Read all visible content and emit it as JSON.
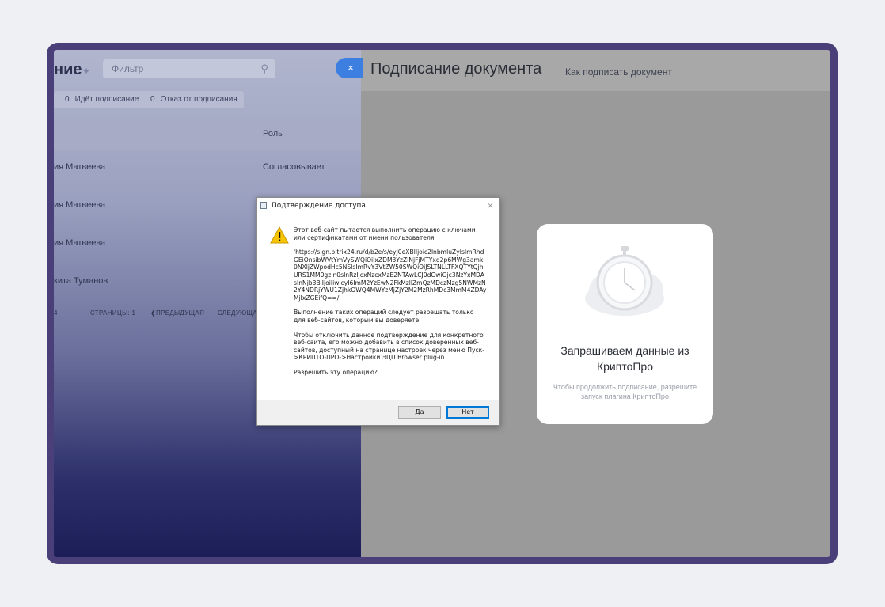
{
  "left_panel": {
    "title_partial": "ние",
    "filter_placeholder": "Фильтр",
    "chips": [
      {
        "count": "0",
        "label": "Идёт подписание"
      },
      {
        "count": "0",
        "label": "Отказ от подписания"
      }
    ],
    "column_role": "Роль",
    "rows": [
      {
        "name": "ия Матвеева",
        "role": "Согласовывает"
      },
      {
        "name": "ия Матвеева",
        "role": ""
      },
      {
        "name": "ия Матвеева",
        "role": ""
      },
      {
        "name": "кита Туманов",
        "role": ""
      }
    ],
    "pager": {
      "first": "4",
      "pages": "СТРАНИЦЫ: 1",
      "prev": "ПРЕДЫДУЩАЯ",
      "next": "СЛЕДУЮЩА"
    }
  },
  "close_glyph": "×",
  "right_panel": {
    "page_title": "Подписание документа",
    "how_link": "Как подписать документ",
    "card": {
      "icon": "stopwatch-cloud-icon",
      "heading": "Запрашиваем данные из КриптоПро",
      "subtext": "Чтобы продолжить подписание, разрешите запуск плагина КриптоПро"
    }
  },
  "dialog": {
    "title": "Подтверждение доступа",
    "intro": "Этот веб-сайт пытается выполнить операцию с ключами или сертификатами от имени пользователя.",
    "url": "'https://sign.bitrix24.ru/d/b2e/s/eyJ0eXBlIjoic2lnbmluZyIsImRhdGEiOnsibWVtYmVySWQiOiIxZDM3YzZiNjFjMTYxd2p6MWg3amk0NXljZWpodHc5NSIsImRvY3VtZW50SWQiOiJSLTNLLTFXQTYtQjhURS1MM0gzIn0sInRzIjoxNzcxMzE2NTAwLCJ0dGwiOjc3NzYxMDAsInNjb3BlIjoiIiwicyI6ImM2YzEwN2FkMzllZmQzMDczMzg5NWMzN2Y4NDRjYWU1ZjhkOWQ4MWYzMjZjY2M2MzRhMDc3MmM4ZDAyMjIxZGEifQ==/'",
    "warning": "Выполнение таких операций следует разрешать только для веб-сайтов, которым вы доверяете.",
    "hint": "Чтобы отключить данное подтверждение для конкретного веб-сайта, его можно добавить в список доверенных веб-сайтов, доступный на странице настроек через меню Пуск->КРИПТО-ПРО->Настройки ЭЦП Browser plug-in.",
    "question": "Разрешить эту операцию?",
    "yes": "Да",
    "no": "Нет",
    "close": "×"
  }
}
